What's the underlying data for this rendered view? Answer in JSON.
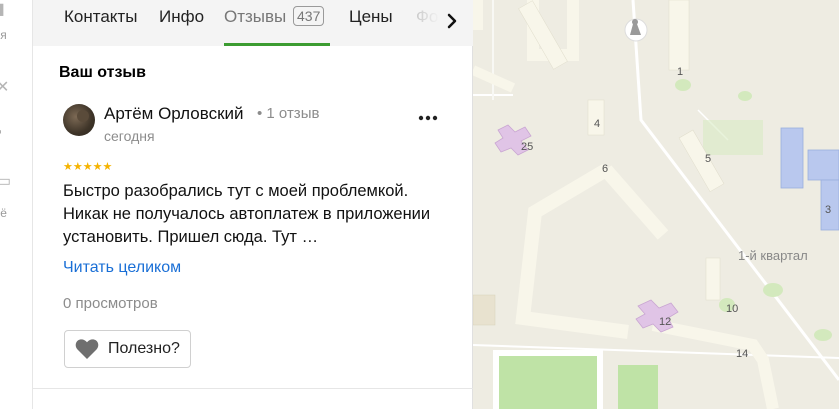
{
  "sidebar": {
    "items": [
      {
        "label": "ья",
        "icon": "bookmark-icon"
      },
      {
        "label": "д",
        "icon": "close-icon"
      },
      {
        "label": "ьё",
        "icon": "bag-icon"
      }
    ]
  },
  "tabs": [
    {
      "label": "Контакты"
    },
    {
      "label": "Инфо"
    },
    {
      "label": "Отзывы",
      "count": "437",
      "active": true
    },
    {
      "label": "Цены"
    },
    {
      "label": "Фо"
    }
  ],
  "review_section": {
    "heading": "Ваш отзыв"
  },
  "review": {
    "author": "Артём Орловский",
    "author_meta": "• 1 отзыв",
    "date": "сегодня",
    "rating": 5,
    "stars": "★★★★★",
    "text": "Быстро разобрались тут с моей проблемкой. Никак не получалось автоплатеж в приложении установить. Пришел сюда. Тут …",
    "read_more": "Читать целиком",
    "views": "0 просмотров",
    "helpful_label": "Полезно?",
    "more_menu": "⋯"
  },
  "map": {
    "building_numbers": [
      "1",
      "4",
      "25",
      "5",
      "6",
      "3",
      "12",
      "10",
      "14"
    ],
    "district": "1-й квартал",
    "colors": {
      "background": "#eeece2",
      "building": "#f8f6ea",
      "school": "#e0c4e6",
      "public": "#b9c8ee",
      "park": "#cfe7b7",
      "road": "#ffffff",
      "field": "#bfe3a6"
    }
  }
}
